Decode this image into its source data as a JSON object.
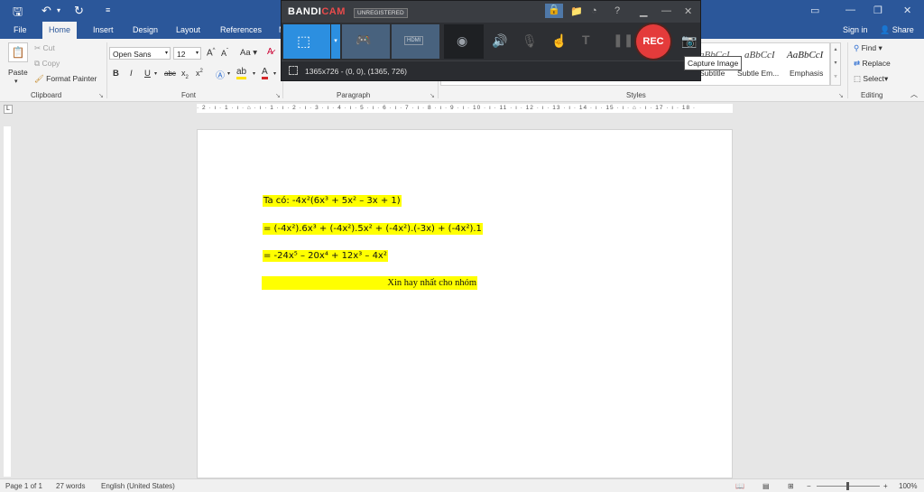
{
  "titlebar": {
    "save_icon": "save-icon",
    "undo_icon": "undo-icon",
    "redo_icon": "redo-icon",
    "customize_icon": "customize-qat-icon"
  },
  "tabs": [
    "File",
    "Home",
    "Insert",
    "Design",
    "Layout",
    "References",
    "M"
  ],
  "tabs_right": {
    "sign_in": "Sign in",
    "share": "Share"
  },
  "clipboard": {
    "paste": "Paste",
    "cut": "Cut",
    "copy": "Copy",
    "format_painter": "Format Painter",
    "label": "Clipboard"
  },
  "font": {
    "family": "Open Sans",
    "size": "12",
    "grow": "A",
    "shrink": "A",
    "case": "Aa",
    "bold": "B",
    "italic": "I",
    "underline": "U",
    "strike": "abc",
    "subscript": "x",
    "superscript": "x",
    "label": "Font"
  },
  "paragraph": {
    "label": "Paragraph"
  },
  "styles": {
    "style1_sample": "aBbCcI",
    "style1_name": "Subtitle",
    "style2_sample": "aBbCcI",
    "style2_name": "Subtle Em...",
    "style3_sample": "AaBbCcI",
    "style3_name": "Emphasis",
    "label": "Styles"
  },
  "editing": {
    "find": "Find",
    "replace": "Replace",
    "select": "Select",
    "label": "Editing"
  },
  "bandicam": {
    "logo_a": "BANDI",
    "logo_b": "CAM",
    "unregistered": "UNREGISTERED",
    "rec": "REC",
    "info": "1365x726 - (0, 0), (1365, 726)",
    "hdmi": "HDMI"
  },
  "tooltip": "Capture Image",
  "ruler": "· 2 · ı · 1 · ı · ⌂ · ı · 1 · ı · 2 · ı · 3 · ı · 4 · ı · 5 · ı · 6 · ı · 7 · ı · 8 · ı · 9 · ı · 10 · ı · 11 · ı · 12 · ı · 13 · ı · 14 · ı · 15 · ı · ⌂ · ı · 17 · ı · 18 ·",
  "document": {
    "line1": "Ta có: -4x²(6x³ + 5x² – 3x + 1)",
    "line2": "= (-4x²).6x³ + (-4x²).5x² + (-4x²).(-3x) + (-4x²).1",
    "line3": "= -24x⁵ – 20x⁴ + 12x³ – 4x²",
    "line4": "Xin hay nhất cho nhóm"
  },
  "status": {
    "page": "Page 1 of 1",
    "words": "27 words",
    "language": "English (United States)",
    "zoom": "100%"
  },
  "colors": {
    "word_blue": "#2b579a",
    "highlight": "#ffff00",
    "rec_red": "#e43b3b",
    "bandicam_blue": "#2c8fe0"
  }
}
